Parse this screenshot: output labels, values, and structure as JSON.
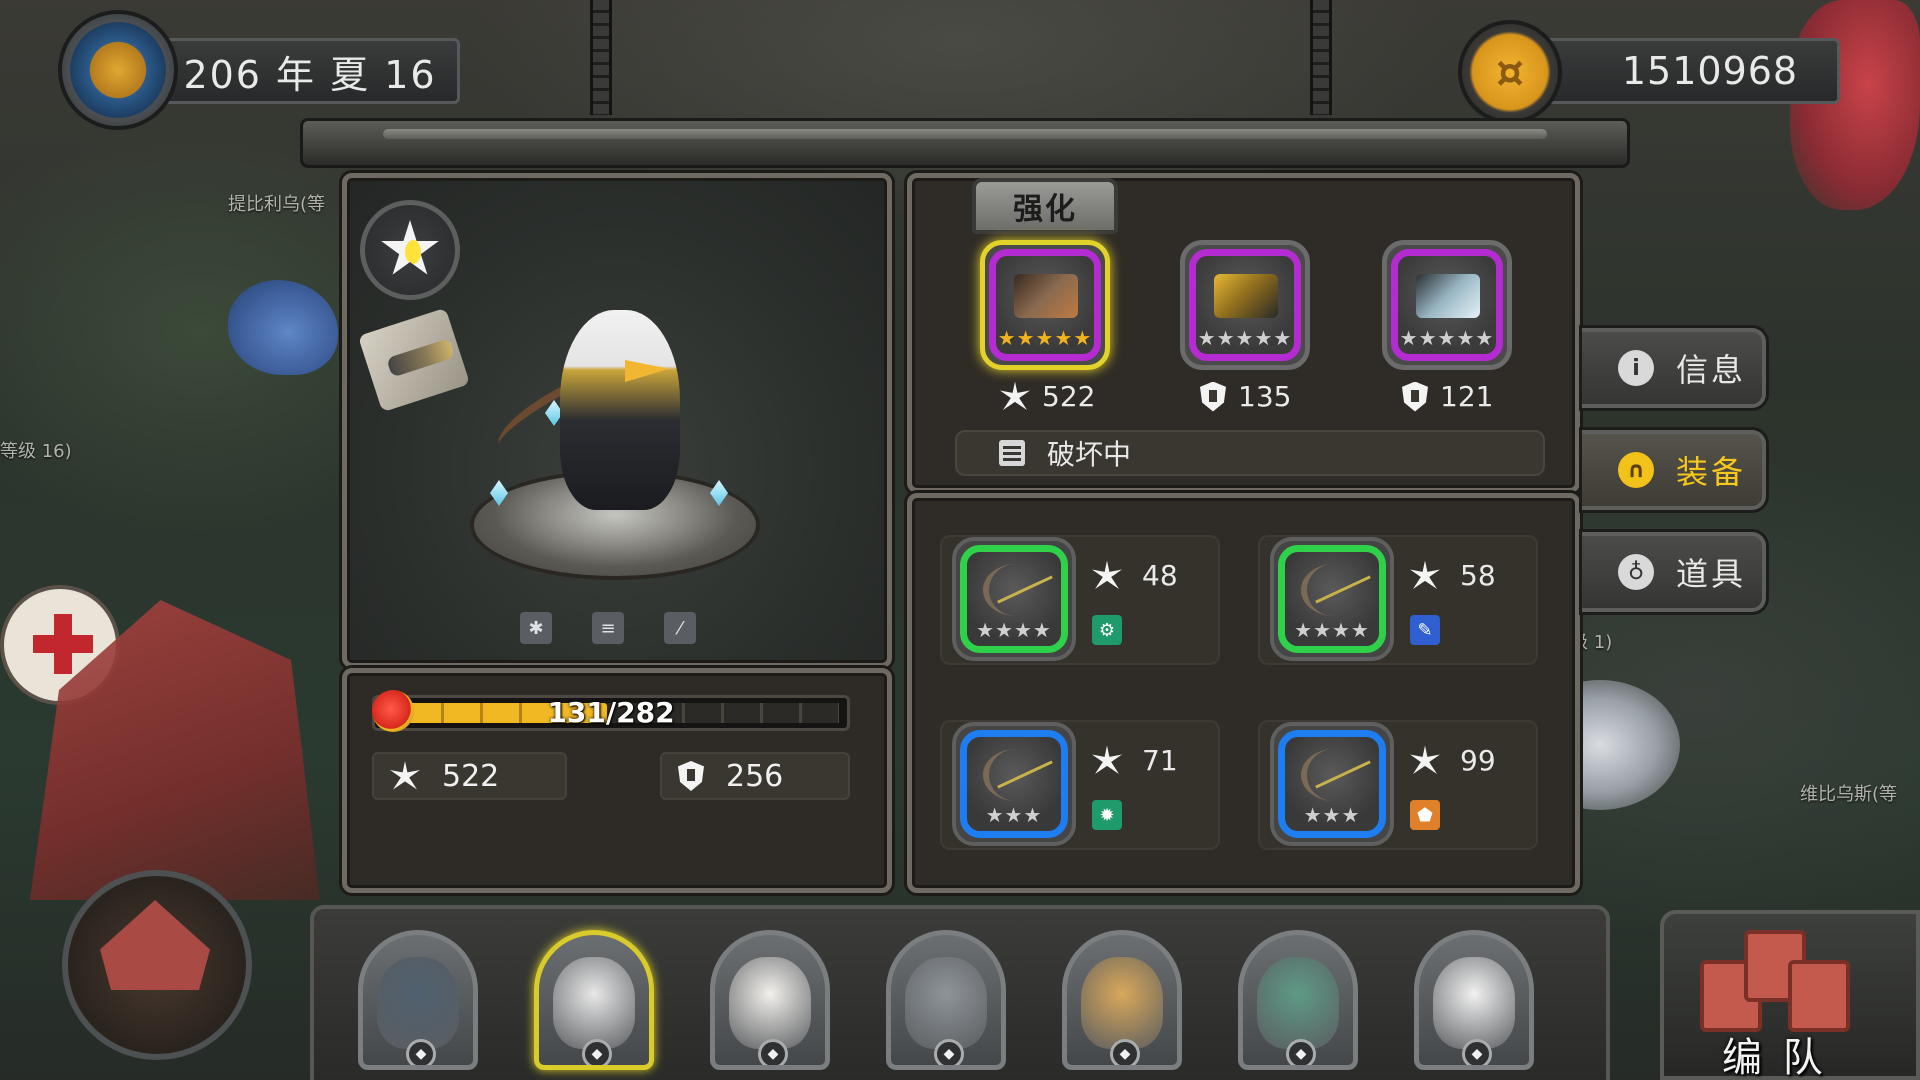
{
  "hud": {
    "date": "206 年 夏 16",
    "coins": "1510968"
  },
  "world_labels": {
    "npc_top_left": "提比利乌(等",
    "npc_left": "等级 16)",
    "npc_right_mid": "(等级 1)",
    "npc_right_bottom": "维比乌斯(等"
  },
  "hero": {
    "hp_current": 131,
    "hp_max": 282,
    "hp_text": "131/282",
    "attack": "522",
    "defense": "256",
    "mini_icons": [
      "snowflake-icon",
      "armor-break-icon",
      "slash-icon"
    ]
  },
  "equipment": {
    "enhance_tab_label": "强化",
    "slots": [
      {
        "type": "weapon",
        "stat_icon": "attack",
        "value": "522",
        "stars": "★★★★★",
        "rarity_color": "#b32bd1",
        "selected": true
      },
      {
        "type": "armor",
        "stat_icon": "defense",
        "value": "135",
        "stars": "★★★★★",
        "rarity_color": "#b32bd1",
        "selected": false
      },
      {
        "type": "accessory",
        "stat_icon": "defense",
        "value": "121",
        "stars": "★★★★★",
        "rarity_color": "#b32bd1",
        "selected": false
      }
    ],
    "status_text": "破坏中"
  },
  "inventory": {
    "items": [
      {
        "attack": "48",
        "stars": "★★★★",
        "rarity": "green",
        "rarity_color": "#2fd14a",
        "skill_color": "#1f9a6a"
      },
      {
        "attack": "58",
        "stars": "★★★★",
        "rarity": "green",
        "rarity_color": "#2fd14a",
        "skill_color": "#2f5fd1"
      },
      {
        "attack": "71",
        "stars": "★★★",
        "rarity": "blue",
        "rarity_color": "#1e7df0",
        "skill_color": "#1f9a6a"
      },
      {
        "attack": "99",
        "stars": "★★★",
        "rarity": "blue",
        "rarity_color": "#1e7df0",
        "skill_color": "#e0802a"
      }
    ]
  },
  "side_tabs": [
    {
      "label": "信息",
      "icon": "info-icon",
      "active": false
    },
    {
      "label": "装备",
      "icon": "helmet-icon",
      "active": true
    },
    {
      "label": "道具",
      "icon": "potion-icon",
      "active": false
    }
  ],
  "roster": {
    "heroes": [
      {
        "name": "pirate-wolf",
        "color": "#50606f",
        "selected": false
      },
      {
        "name": "eagle-archer",
        "color": "#e8e8e8",
        "selected": true
      },
      {
        "name": "alpaca",
        "color": "#f2f0ec",
        "selected": false
      },
      {
        "name": "elephant",
        "color": "#8e9499",
        "selected": false
      },
      {
        "name": "giraffe",
        "color": "#d9a85a",
        "selected": false
      },
      {
        "name": "crocodile",
        "color": "#5e9a86",
        "selected": false
      },
      {
        "name": "polar-bear",
        "color": "#f1f1f1",
        "selected": false
      }
    ],
    "team_label": "编 队"
  },
  "colors": {
    "accent_gold": "#f6c81c",
    "epic_purple": "#b32bd1",
    "uncommon_green": "#2fd14a",
    "rare_blue": "#1e7df0"
  }
}
